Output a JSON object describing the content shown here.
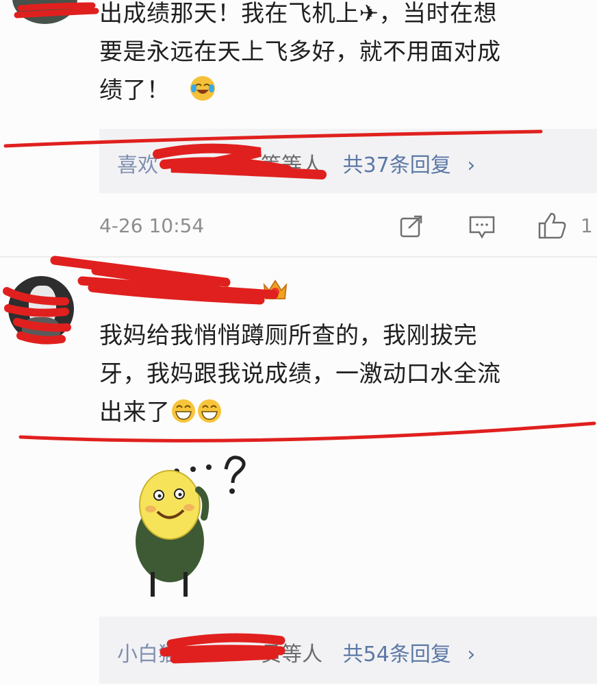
{
  "comment1": {
    "line1": "出成绩那天！我在飞机上✈，当时在想",
    "line2": "要是永远在天上飞多好，就不用面对成",
    "line3": "绩了！",
    "reply_summary": {
      "names": "喜欢",
      "suffix": "等等人",
      "link": "共37条回复",
      "chevron": "›"
    },
    "timestamp": "4-26 10:54",
    "like_count": "1"
  },
  "comment2": {
    "username_tail": "O",
    "line1": "我妈给我悄悄蹲厕所查的，我刚拔完",
    "line2": "牙，我妈跟我说成绩，一激动口水全流",
    "line3": "出来了",
    "reply_summary": {
      "names": "小白猫",
      "suffix": "员等人",
      "link": "共54条回复",
      "chevron": "›"
    }
  },
  "sticker": {
    "question": "…?"
  },
  "colors": {
    "link": "#5b78a6",
    "scribble": "#e0201e",
    "reply_bg": "#f2f2f4"
  },
  "icons": [
    "avatar",
    "airplane-icon",
    "laughing-crying-emoji",
    "share-icon",
    "comment-icon",
    "like-icon",
    "crown-badge-icon",
    "grin-emoji",
    "confused-sticker"
  ]
}
